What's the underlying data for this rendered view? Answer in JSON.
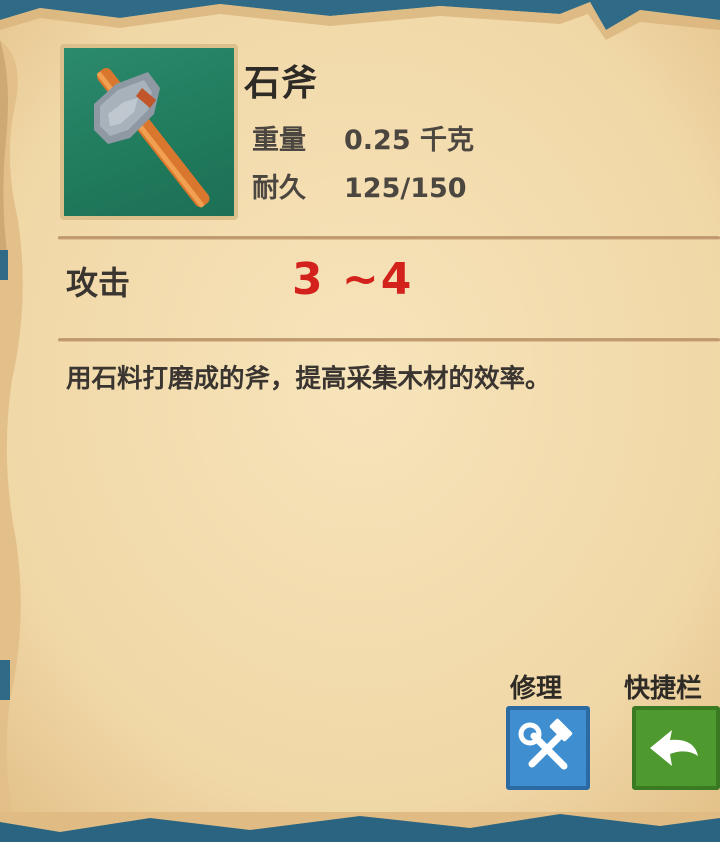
{
  "item": {
    "name": "石斧",
    "icon": "stone-axe-icon",
    "stats": [
      {
        "label": "重量",
        "value": "0.25 千克"
      },
      {
        "label": "耐久",
        "value": "125/150"
      }
    ]
  },
  "attack": {
    "label": "攻击",
    "value": "3 ~4"
  },
  "description": "用石料打磨成的斧，提高采集木材的效率。",
  "actions": {
    "repair": {
      "label": "修理",
      "icon": "hammer-wrench-icon"
    },
    "hotbar": {
      "label": "快捷栏",
      "icon": "arrow-left-icon"
    }
  },
  "colors": {
    "parchment": "#f2dcae",
    "attack_value": "#d3221c",
    "repair_button": "#3f8ed0",
    "hotbar_button": "#4f9a2e",
    "icon_background": "#217c5e"
  }
}
